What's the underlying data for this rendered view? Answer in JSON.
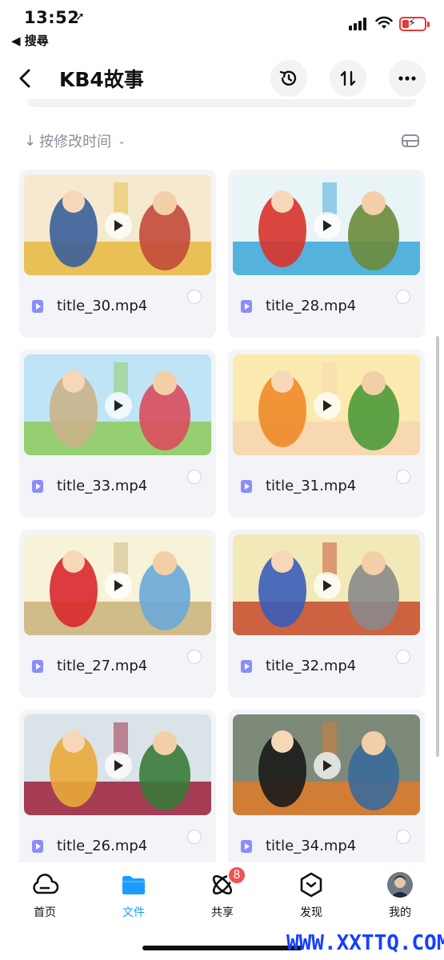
{
  "status_bar": {
    "time": "13:52",
    "location_glyph": "➚",
    "back_app": "◀ 搜尋",
    "battery_color": "#e53935"
  },
  "header": {
    "title": "KB4故事",
    "icons": [
      "back-icon",
      "history-icon",
      "sort-icon",
      "more-icon"
    ]
  },
  "sort_bar": {
    "label": "按修改时间",
    "arrow": "↓",
    "chevron": "⌄",
    "view_icon": "list-view-icon"
  },
  "files": [
    {
      "name": "title_30.mp4",
      "thumb_colors": [
        "#f5ead0",
        "#e6b93f",
        "#3a5f9a",
        "#c24a3a"
      ]
    },
    {
      "name": "title_28.mp4",
      "thumb_colors": [
        "#e9f4f7",
        "#3aa6d8",
        "#d8332a",
        "#6b8b3a"
      ]
    },
    {
      "name": "title_33.mp4",
      "thumb_colors": [
        "#bfe4f5",
        "#8ecb5a",
        "#c9b28a",
        "#d94c5c"
      ]
    },
    {
      "name": "title_31.mp4",
      "thumb_colors": [
        "#fbeab0",
        "#f6d5b0",
        "#ef8a2a",
        "#4c9a3a"
      ]
    },
    {
      "name": "title_27.mp4",
      "thumb_colors": [
        "#f7f3d9",
        "#c9b27a",
        "#d9272e",
        "#6aa9d8"
      ]
    },
    {
      "name": "title_32.mp4",
      "thumb_colors": [
        "#f2e9b8",
        "#c74a2a",
        "#3a5db8",
        "#8a8a8a"
      ]
    },
    {
      "name": "title_26.mp4",
      "thumb_colors": [
        "#d9e3e8",
        "#9b1f3a",
        "#e9a83a",
        "#3a7a3a"
      ]
    },
    {
      "name": "title_34.mp4",
      "thumb_colors": [
        "#7d8a7a",
        "#e07a2a",
        "#1a1a1a",
        "#3a6a9a"
      ]
    }
  ],
  "tabbar": {
    "tabs": [
      {
        "label": "首页",
        "icon": "cloud-icon"
      },
      {
        "label": "文件",
        "icon": "folder-icon"
      },
      {
        "label": "共享",
        "icon": "share-atom-icon"
      },
      {
        "label": "发现",
        "icon": "discover-box-icon"
      },
      {
        "label": "我的",
        "icon": "avatar"
      }
    ],
    "active_index": 1,
    "active_color": "#1e9bff",
    "share_badge": "8"
  },
  "watermark": "WWW.XXTTQ.COM"
}
